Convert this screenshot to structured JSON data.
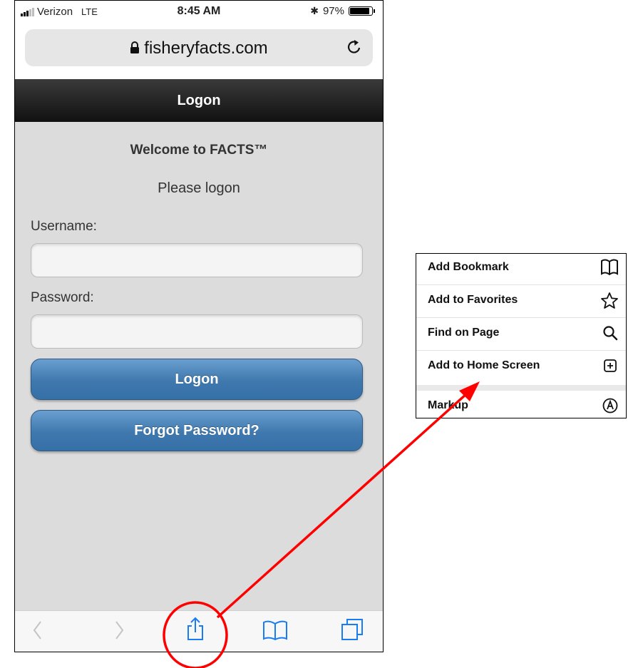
{
  "status_bar": {
    "carrier": "Verizon",
    "network": "LTE",
    "time": "8:45 AM",
    "bluetooth": "✱",
    "battery": "97%"
  },
  "browser": {
    "url": "fisheryfacts.com",
    "lock_icon": "lock-icon",
    "reload_icon": "reload-icon"
  },
  "page": {
    "header": "Logon",
    "welcome": "Welcome to FACTS™",
    "subtitle": "Please logon",
    "username_label": "Username:",
    "username_value": "",
    "password_label": "Password:",
    "password_value": "",
    "logon_button": "Logon",
    "forgot_button": "Forgot Password?",
    "button_color": "#3f78ad",
    "header_color": "#1c1c1c",
    "background_color": "#dcdcdc"
  },
  "toolbar": {
    "icons": [
      "back-icon",
      "forward-icon",
      "share-icon",
      "bookmarks-icon",
      "tabs-icon"
    ]
  },
  "share_menu": {
    "items": [
      {
        "label": "Add Bookmark",
        "icon": "book-icon"
      },
      {
        "label": "Add to Favorites",
        "icon": "star-icon"
      },
      {
        "label": "Find on Page",
        "icon": "magnifier-icon"
      },
      {
        "label": "Add to Home Screen",
        "icon": "plus-square-icon"
      },
      {
        "label": "Markup",
        "icon": "markup-icon"
      }
    ]
  },
  "annotation": {
    "color": "#ff0000"
  }
}
